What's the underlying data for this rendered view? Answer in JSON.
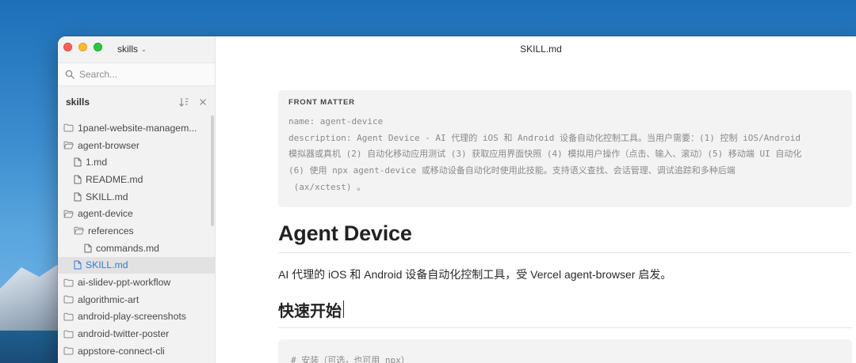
{
  "window": {
    "folder_switcher": "skills",
    "title": "SKILL.md"
  },
  "sidebar": {
    "search_placeholder": "Search...",
    "title": "skills",
    "items": [
      {
        "label": "1panel-website-managem...",
        "type": "folder",
        "depth": 0,
        "expanded": false,
        "active": false
      },
      {
        "label": "agent-browser",
        "type": "folder",
        "depth": 0,
        "expanded": true,
        "active": false
      },
      {
        "label": "1.md",
        "type": "file",
        "depth": 1,
        "active": false
      },
      {
        "label": "README.md",
        "type": "file",
        "depth": 1,
        "active": false
      },
      {
        "label": "SKILL.md",
        "type": "file",
        "depth": 1,
        "active": false
      },
      {
        "label": "agent-device",
        "type": "folder",
        "depth": 0,
        "expanded": true,
        "active": false
      },
      {
        "label": "references",
        "type": "folder",
        "depth": 1,
        "expanded": true,
        "active": false
      },
      {
        "label": "commands.md",
        "type": "file",
        "depth": 2,
        "active": false
      },
      {
        "label": "SKILL.md",
        "type": "file",
        "depth": 1,
        "active": true
      },
      {
        "label": "ai-slidev-ppt-workflow",
        "type": "folder",
        "depth": 0,
        "expanded": false,
        "active": false
      },
      {
        "label": "algorithmic-art",
        "type": "folder",
        "depth": 0,
        "expanded": false,
        "active": false
      },
      {
        "label": "android-play-screenshots",
        "type": "folder",
        "depth": 0,
        "expanded": false,
        "active": false
      },
      {
        "label": "android-twitter-poster",
        "type": "folder",
        "depth": 0,
        "expanded": false,
        "active": false
      },
      {
        "label": "appstore-connect-cli",
        "type": "folder",
        "depth": 0,
        "expanded": false,
        "active": false
      }
    ]
  },
  "document": {
    "front_matter_label": "FRONT MATTER",
    "front_matter_lines": [
      "name: agent-device",
      "description: Agent Device - AI 代理的 iOS 和 Android 设备自动化控制工具。当用户需要：(1) 控制 iOS/Android",
      "模拟器或真机 (2) 自动化移动应用测试 (3) 获取应用界面快照 (4) 模拟用户操作（点击、输入、滚动）(5) 移动端 UI 自动化",
      "(6) 使用 npx agent-device 或移动设备自动化时使用此技能。支持语义查找、会话管理、调试追踪和多种后端",
      " (ax/xctest) 。"
    ],
    "heading1": "Agent Device",
    "paragraph": "AI 代理的 iOS 和 Android 设备自动化控制工具，受 Vercel agent-browser 启发。",
    "heading2": "快速开始",
    "code_first_line": "# 安装（可选，也可用 npx）"
  },
  "colors": {
    "accent": "#2f7bd6",
    "active_row_bg": "#e2e2e2",
    "sidebar_bg": "#f2f2f2",
    "code_bg": "#f3f3f3"
  }
}
